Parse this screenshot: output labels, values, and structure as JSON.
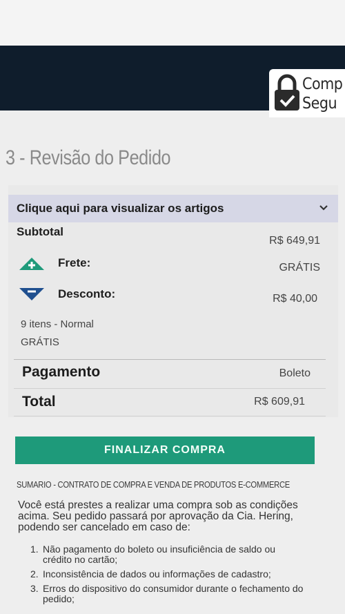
{
  "header": {
    "secure_line1": "Comp",
    "secure_line2": "Segu"
  },
  "page": {
    "title": "3 - Revisão do Pedido"
  },
  "summary": {
    "toggle_label": "Clique aqui para visualizar os artigos",
    "subtotal_label": "Subtotal",
    "subtotal_value": "R$ 649,91",
    "frete_label": "Frete:",
    "frete_value": "GRÁTIS",
    "desconto_label": "Desconto:",
    "desconto_value": "R$ 40,00",
    "shipping_method": "9 itens - Normal",
    "shipping_price": "GRÁTIS",
    "pagamento_label": "Pagamento",
    "pagamento_value": "Boleto",
    "total_label": "Total",
    "total_value": "R$ 609,91"
  },
  "actions": {
    "finalize_label": "FINALIZAR COMPRA"
  },
  "contract": {
    "heading": "SUMARIO - CONTRATO DE COMPRA E VENDA DE PRODUTOS E-COMMERCE",
    "intro": "Você está prestes a realizar uma compra sob as condições acima. Seu pedido passará por aprovação da Cia. Hering, podendo ser cancelado em caso de:",
    "items": [
      {
        "num": "1.",
        "text": "Não pagamento do boleto ou insuficiência de saldo ou crédito no cartão;"
      },
      {
        "num": "2.",
        "text": "Inconsistência de dados ou informações de cadastro;"
      },
      {
        "num": "3.",
        "text": "Erros do dispositivo do consumidor durante o fechamento do pedido;"
      }
    ]
  },
  "colors": {
    "header_bg": "#0f1d2c",
    "accent_green": "#1e9a7a",
    "discount_blue": "#1f4f8f",
    "toggle_bg": "#d6d7e6"
  },
  "icons": {
    "lock": "lock-check-icon",
    "frete": "triangle-up-plus-icon",
    "desconto": "triangle-down-minus-icon",
    "chevron": "chevron-down-icon"
  }
}
